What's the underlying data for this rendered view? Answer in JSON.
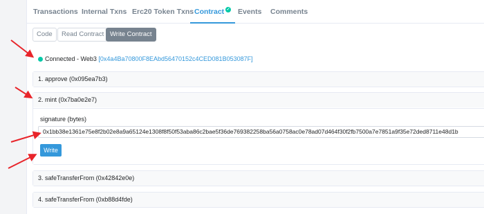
{
  "tabs": [
    {
      "label": "Transactions"
    },
    {
      "label": "Internal Txns"
    },
    {
      "label": "Erc20 Token Txns"
    },
    {
      "label": "Contract"
    },
    {
      "label": "Events"
    },
    {
      "label": "Comments"
    }
  ],
  "active_tab": "Contract",
  "subtabs": [
    {
      "label": "Code"
    },
    {
      "label": "Read Contract"
    },
    {
      "label": "Write Contract"
    }
  ],
  "connection": {
    "status": "Connected - Web3",
    "address": "0x4a4Ba70800F8EAbd56470152c4CED081B053087F",
    "open_bracket": "[",
    "close_bracket": "]"
  },
  "functions": [
    {
      "label": "1. approve (0x095ea7b3)"
    },
    {
      "label": "2. mint (0x7ba0e2e7)",
      "param_label": "signature (bytes)",
      "param_value": "0x1bb38e1361e75e8f2b02e8a9a65124e1308f8f50f53aba86c2bae5f36de769382258ba56a0758ac0e78ad07d464f30f2fb7500a7e7851a9f35e72ded8711e48d1b",
      "button": "Write"
    },
    {
      "label": "3. safeTransferFrom (0x42842e0e)"
    },
    {
      "label": "4. safeTransferFrom (0xb88d4fde)"
    }
  ],
  "colors": {
    "accent": "#3498db",
    "connected": "#00c9a7",
    "arrow": "#e8242a"
  }
}
